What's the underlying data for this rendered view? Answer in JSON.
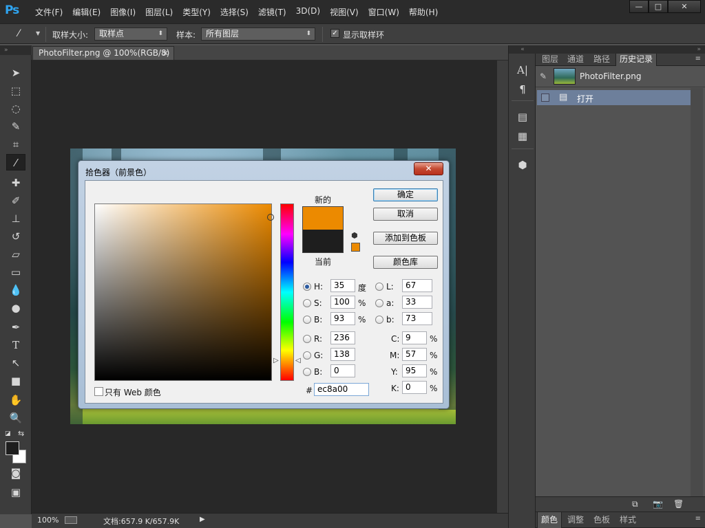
{
  "app": {
    "logo": "Ps"
  },
  "menu": [
    "文件(F)",
    "编辑(E)",
    "图像(I)",
    "图层(L)",
    "类型(Y)",
    "选择(S)",
    "滤镜(T)",
    "3D(D)",
    "视图(V)",
    "窗口(W)",
    "帮助(H)"
  ],
  "window_controls": {
    "minimize": "—",
    "maximize": "□",
    "close": "✕"
  },
  "options": {
    "sample_size_label": "取样大小:",
    "sample_size_value": "取样点",
    "sample_label": "样本:",
    "sample_value": "所有图层",
    "show_ring_label": "显示取样环",
    "show_ring_checked": true
  },
  "document": {
    "tab_title": "PhotoFilter.png @ 100%(RGB/8)",
    "tab_close": "✕"
  },
  "status": {
    "zoom": "100%",
    "doc_info": "文档:657.9 K/657.9K"
  },
  "right_panel": {
    "tabs": [
      "图层",
      "通道",
      "路径",
      "历史记录"
    ],
    "active_tab": "历史记录",
    "snapshot_name": "PhotoFilter.png",
    "history_items": [
      "打开"
    ],
    "bottom_tabs": [
      "颜色",
      "调整",
      "色板",
      "样式"
    ],
    "active_bottom_tab": "颜色"
  },
  "dialog": {
    "title": "拾色器（前景色）",
    "close": "✕",
    "label_new": "新的",
    "label_current": "当前",
    "new_color": "#ec8a00",
    "current_color": "#1e1e1e",
    "buttons": {
      "ok": "确定",
      "cancel": "取消",
      "add_swatch": "添加到色板",
      "libraries": "颜色库"
    },
    "hsb": {
      "h": "35",
      "s": "100",
      "b": "93",
      "h_unit": "度",
      "s_unit": "%",
      "b_unit": "%"
    },
    "lab": {
      "l": "67",
      "a": "33",
      "b": "73"
    },
    "rgb": {
      "r": "236",
      "g": "138",
      "b": "0"
    },
    "cmyk": {
      "c": "9",
      "m": "57",
      "y": "95",
      "k": "0",
      "unit": "%"
    },
    "hex": "ec8a00",
    "labels": {
      "h": "H:",
      "s": "S:",
      "bri": "B:",
      "l": "L:",
      "a": "a:",
      "lb": "b:",
      "r": "R:",
      "g": "G:",
      "blue": "B:",
      "c": "C:",
      "m": "M:",
      "y": "Y:",
      "k": "K:",
      "hash": "#"
    },
    "web_only_label": "只有 Web 颜色",
    "web_only_checked": false,
    "selected_mode": "H"
  }
}
